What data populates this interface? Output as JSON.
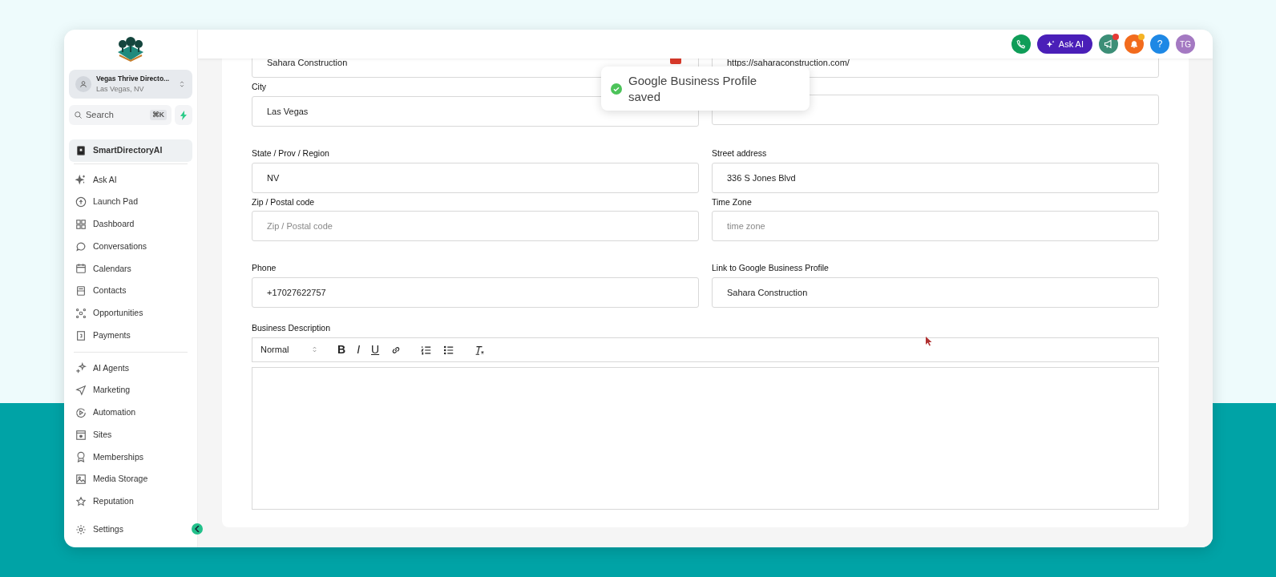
{
  "sidebar": {
    "account": {
      "name": "Vegas Thrive Directo...",
      "location": "Las Vegas, NV"
    },
    "search": {
      "placeholder": "Search",
      "shortcut": "⌘K"
    },
    "pinned": [
      {
        "label": "SmartDirectoryAI",
        "selected": true
      }
    ],
    "groups": [
      [
        {
          "label": "Ask AI",
          "selected": false
        },
        {
          "label": "Launch Pad",
          "selected": false
        },
        {
          "label": "Dashboard",
          "selected": false
        },
        {
          "label": "Conversations",
          "selected": false
        },
        {
          "label": "Calendars",
          "selected": false
        },
        {
          "label": "Contacts",
          "selected": false
        },
        {
          "label": "Opportunities",
          "selected": false
        },
        {
          "label": "Payments",
          "selected": false
        }
      ],
      [
        {
          "label": "AI Agents",
          "selected": false
        },
        {
          "label": "Marketing",
          "selected": false
        },
        {
          "label": "Automation",
          "selected": false
        },
        {
          "label": "Sites",
          "selected": false
        },
        {
          "label": "Memberships",
          "selected": false
        },
        {
          "label": "Media Storage",
          "selected": false
        },
        {
          "label": "Reputation",
          "selected": false
        }
      ]
    ],
    "settings": {
      "label": "Settings"
    }
  },
  "topbar": {
    "ask_ai": "Ask AI",
    "help": "?",
    "avatar": "TG",
    "announcements_unread": true,
    "notifications_unread": true
  },
  "form": {
    "rows": [
      [
        {
          "value": "Sahara Construction",
          "flag": true
        },
        {
          "value": "https://saharaconstruction.com/"
        }
      ],
      [
        {
          "label": "City",
          "value": "Las Vegas"
        },
        {}
      ],
      [
        {
          "label": "State / Prov / Region",
          "value": "NV"
        },
        {
          "label": "Street address",
          "value": "336 S Jones Blvd"
        }
      ],
      [
        {
          "label": "Zip / Postal code",
          "placeholder": "Zip / Postal code"
        },
        {
          "label": "Time Zone",
          "placeholder": "time zone"
        }
      ],
      [
        {
          "label": "Phone",
          "value": "+17027622757"
        },
        {
          "label": "Link to Google Business Profile",
          "value": "Sahara Construction"
        }
      ]
    ],
    "description": {
      "label": "Business Description",
      "format": "Normal",
      "tools": [
        {
          "kind": "bold",
          "label": "B"
        },
        {
          "kind": "italic",
          "label": "I"
        },
        {
          "kind": "underline",
          "label": "U"
        },
        {
          "kind": "link"
        },
        {
          "kind": "ordered"
        },
        {
          "kind": "bullet"
        },
        {
          "kind": "clear"
        }
      ]
    }
  },
  "toast": {
    "message": "Google Business Profile saved"
  }
}
